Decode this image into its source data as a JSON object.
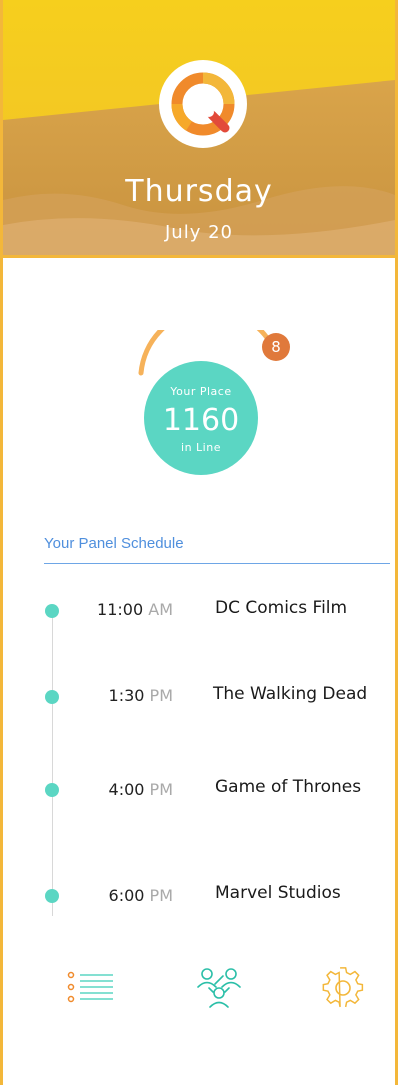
{
  "header": {
    "day": "Thursday",
    "date": "July 20",
    "logo_icon": "q-logo-icon"
  },
  "queue": {
    "label_top": "Your Place",
    "number": "1160",
    "label_bottom": "in Line",
    "badge": "8",
    "progress": 0.35
  },
  "schedule": {
    "title": "Your Panel Schedule",
    "items": [
      {
        "time": "11:00",
        "ampm": "AM",
        "name": "DC Comics Film"
      },
      {
        "time": "1:30",
        "ampm": "PM",
        "name": "The Walking Dead"
      },
      {
        "time": "4:00",
        "ampm": "PM",
        "name": "Game of Thrones"
      },
      {
        "time": "6:00",
        "ampm": "PM",
        "name": "Marvel Studios"
      }
    ]
  },
  "tabs": [
    {
      "icon": "list-icon"
    },
    {
      "icon": "people-icon"
    },
    {
      "icon": "gear-icon"
    }
  ],
  "colors": {
    "accent_yellow": "#f3b73a",
    "accent_teal": "#5bd6c3",
    "accent_orange": "#e0793b",
    "link_blue": "#4f8fdd"
  }
}
